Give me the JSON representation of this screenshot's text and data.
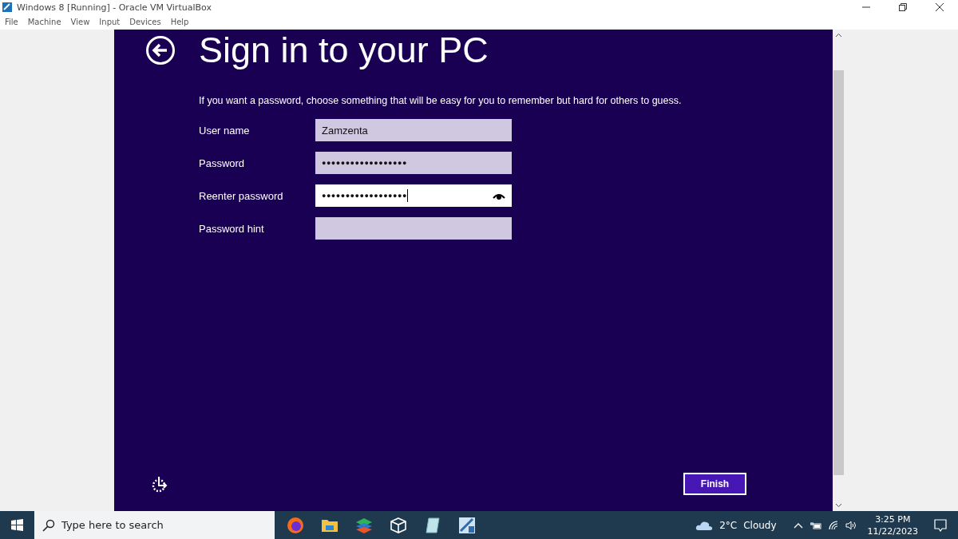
{
  "window": {
    "title": "Windows 8 [Running] - Oracle VM VirtualBox",
    "menu": [
      "File",
      "Machine",
      "View",
      "Input",
      "Devices",
      "Help"
    ]
  },
  "setup": {
    "title": "Sign in to your PC",
    "intro": "If you want a password, choose something that will be easy for you to remember but hard for others to guess.",
    "fields": [
      {
        "label": "User name",
        "value": "Zamzenta",
        "focused": false,
        "kind": "text"
      },
      {
        "label": "Password",
        "value": "●●●●●●●●●●●●●●●●●●",
        "focused": false,
        "kind": "password"
      },
      {
        "label": "Reenter password",
        "value": "●●●●●●●●●●●●●●●●●●",
        "focused": true,
        "kind": "password"
      },
      {
        "label": "Password hint",
        "focused": false,
        "kind": "text"
      }
    ],
    "finish": "Finish"
  },
  "taskbar": {
    "search_placeholder": "Type here to search",
    "temperature": "2°C",
    "weather": "Cloudy",
    "time": "3:25 PM",
    "date": "11/22/2023"
  }
}
